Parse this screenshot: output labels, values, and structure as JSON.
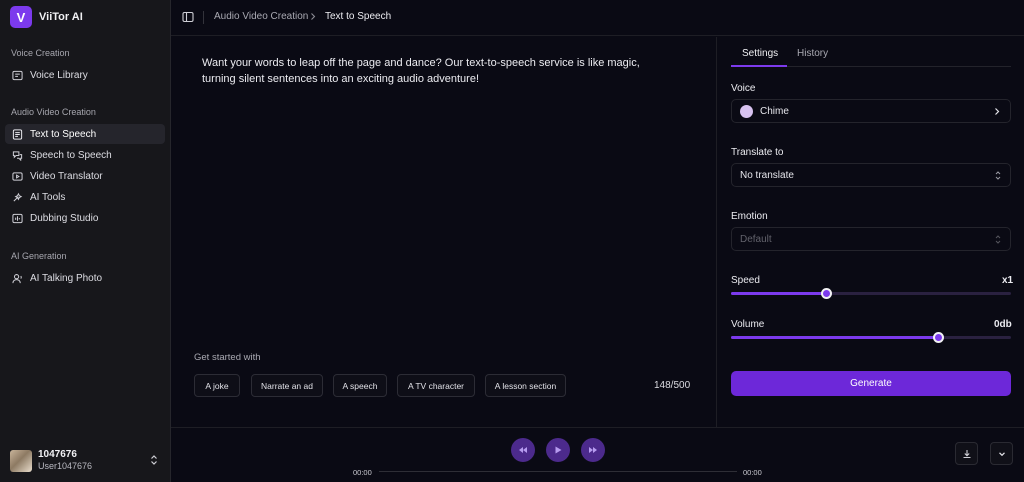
{
  "app": {
    "name": "ViiTor AI",
    "logo_letter": "V"
  },
  "sidebar": {
    "sections": [
      {
        "title": "Voice Creation",
        "items": [
          {
            "label": "Voice Library",
            "icon": "voice-library-icon"
          }
        ]
      },
      {
        "title": "Audio Video Creation",
        "items": [
          {
            "label": "Text to Speech",
            "icon": "document-text-icon",
            "active": true
          },
          {
            "label": "Speech to Speech",
            "icon": "speech-convert-icon"
          },
          {
            "label": "Video Translator",
            "icon": "video-translate-icon"
          },
          {
            "label": "AI Tools",
            "icon": "ai-tools-icon"
          },
          {
            "label": "Dubbing Studio",
            "icon": "dubbing-icon"
          }
        ]
      },
      {
        "title": "AI Generation",
        "items": [
          {
            "label": "AI Talking Photo",
            "icon": "talking-photo-icon"
          }
        ]
      }
    ],
    "user": {
      "name": "1047676",
      "id": "User1047676"
    }
  },
  "breadcrumb": {
    "parent": "Audio Video Creation",
    "current": "Text to Speech"
  },
  "editor": {
    "text": "Want your words to leap off the page and dance? Our text-to-speech service is like magic, turning silent sentences into an exciting audio adventure!",
    "get_started_label": "Get started with",
    "chips": [
      "A joke",
      "Narrate an ad",
      "A speech",
      "A TV character",
      "A lesson section"
    ],
    "counter": "148/500"
  },
  "settings": {
    "tabs": [
      "Settings",
      "History"
    ],
    "active_tab": "Settings",
    "voice": {
      "label": "Voice",
      "value": "Chime"
    },
    "translate": {
      "label": "Translate to",
      "value": "No translate"
    },
    "emotion": {
      "label": "Emotion",
      "value": "Default"
    },
    "speed": {
      "label": "Speed",
      "value": "x1",
      "position": 0.34
    },
    "volume": {
      "label": "Volume",
      "value": "0db",
      "position": 0.74
    },
    "generate_label": "Generate"
  },
  "player": {
    "current_time": "00:00",
    "total_time": "00:00"
  },
  "colors": {
    "accent": "#7c3aed",
    "background": "#0a0a14",
    "sidebar": "#17171b"
  }
}
